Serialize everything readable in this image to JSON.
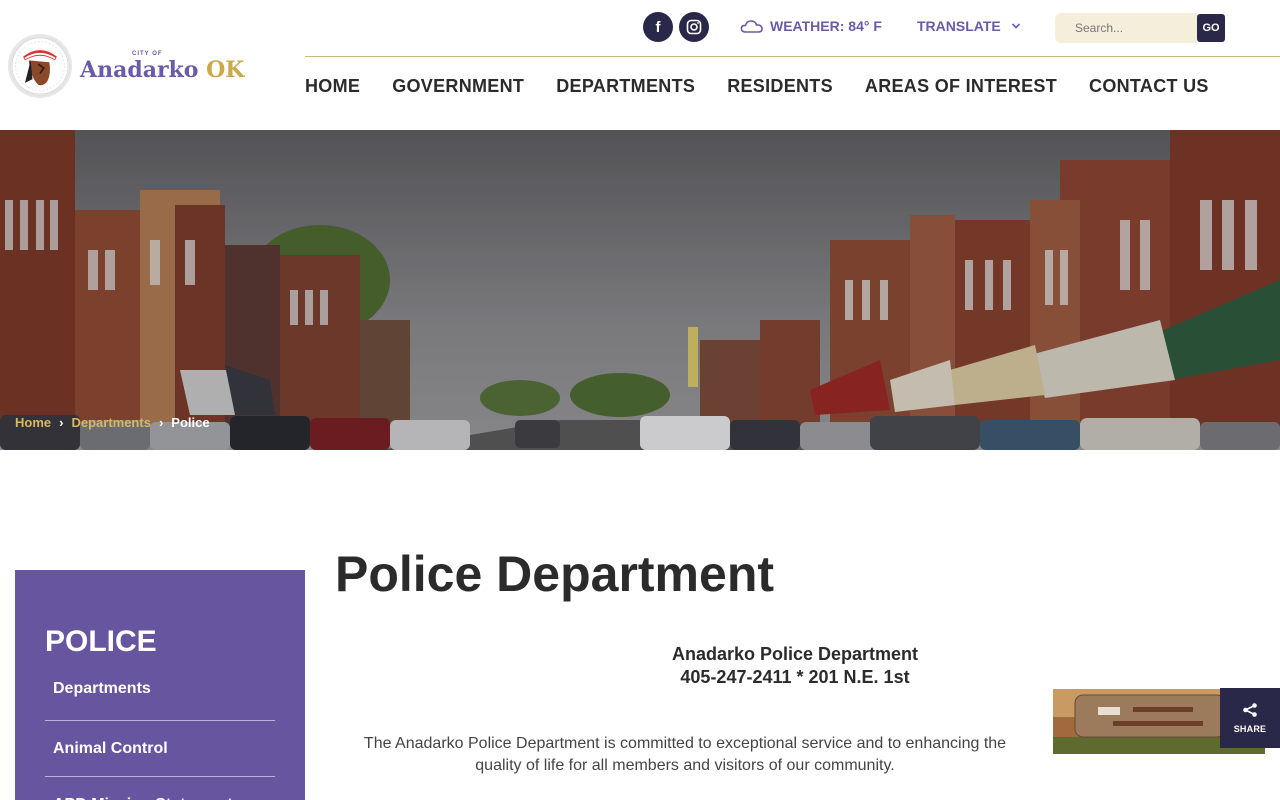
{
  "header": {
    "logo": {
      "city_of": "CITY OF",
      "name_main": "Anadarko",
      "name_accent": "OK"
    },
    "social": {
      "facebook_icon": "f",
      "instagram_icon": "◎"
    },
    "weather": {
      "label": "WEATHER: 84° F",
      "icon": "cloud-icon"
    },
    "translate": {
      "label": "TRANSLATE",
      "icon": "chevron-down-icon"
    },
    "search": {
      "placeholder": "Search...",
      "button_label": "GO"
    },
    "nav": [
      {
        "label": "HOME"
      },
      {
        "label": "GOVERNMENT"
      },
      {
        "label": "DEPARTMENTS"
      },
      {
        "label": "RESIDENTS"
      },
      {
        "label": "AREAS OF INTEREST"
      },
      {
        "label": "CONTACT US"
      }
    ]
  },
  "breadcrumb": {
    "items": [
      {
        "label": "Home"
      },
      {
        "label": "Departments"
      }
    ],
    "current": "Police",
    "separator": "›"
  },
  "sidebar": {
    "title": "POLICE",
    "links": [
      {
        "label": "Departments"
      },
      {
        "label": "Animal Control"
      },
      {
        "label": "APD Mission Statement"
      }
    ]
  },
  "main": {
    "title": "Police Department",
    "dept_name": "Anadarko Police Department",
    "dept_contact": "405-247-2411 * 201 N.E. 1st",
    "intro": "The Anadarko Police Department is committed to exceptional service and to enhancing the quality of life for all members and visitors of our community."
  },
  "share": {
    "label": "SHARE",
    "icon": "share-icon"
  },
  "colors": {
    "brand_purple": "#67559f",
    "accent_gold": "#c9a94c",
    "dark_navy": "#2a2848",
    "search_bg": "#f4eedb"
  }
}
